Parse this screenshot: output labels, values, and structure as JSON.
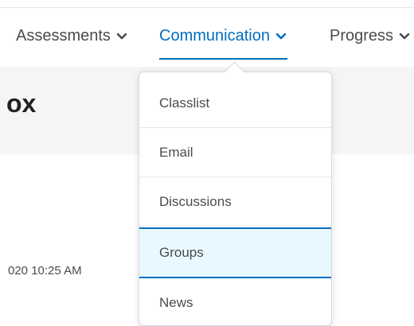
{
  "nav": {
    "items": [
      {
        "label": "Assessments"
      },
      {
        "label": "Communication"
      },
      {
        "label": "Progress"
      }
    ]
  },
  "page": {
    "title": "ox"
  },
  "content": {
    "timestamp": "020 10:25 AM"
  },
  "dropdown": {
    "items": [
      {
        "label": "Classlist"
      },
      {
        "label": "Email"
      },
      {
        "label": "Discussions"
      },
      {
        "label": "Groups"
      },
      {
        "label": "News"
      }
    ]
  },
  "colors": {
    "accent": "#006fbf",
    "highlight": "#e8f8ff",
    "text": "#494c4e"
  }
}
